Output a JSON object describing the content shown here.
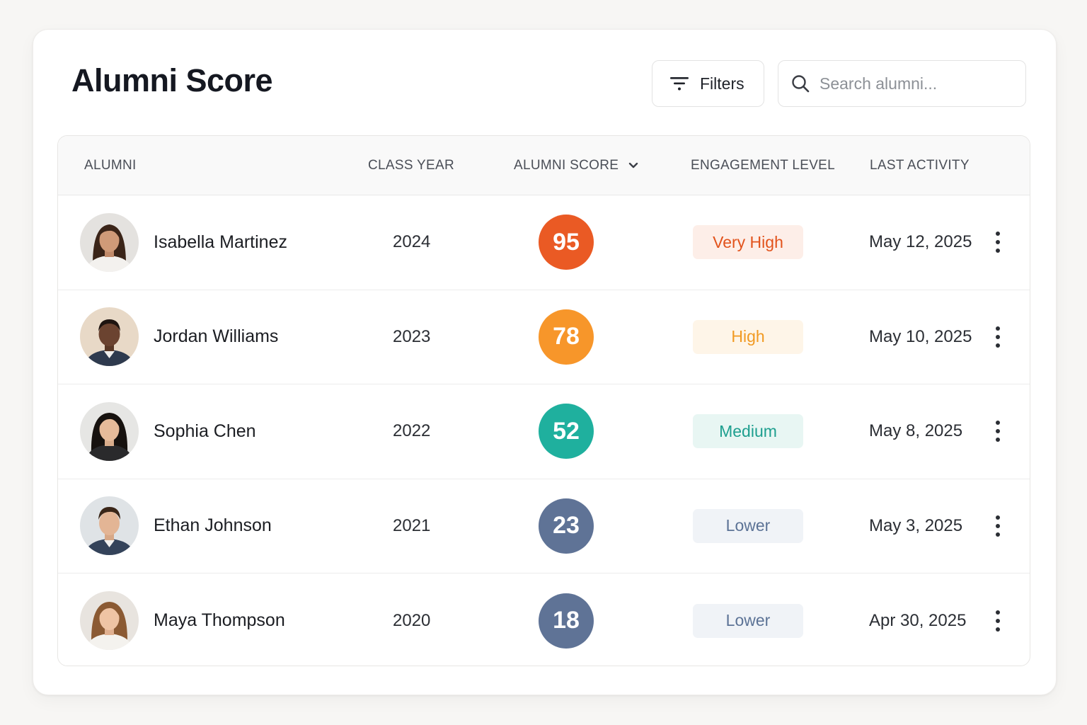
{
  "page": {
    "title": "Alumni Score",
    "filters_label": "Filters",
    "search_placeholder": "Search alumni..."
  },
  "columns": {
    "alumni": "ALUMNI",
    "class_year": "CLASS YEAR",
    "alumni_score": "ALUMNI SCORE",
    "engagement_level": "ENGAGEMENT LEVEL",
    "last_activity": "LAST ACTIVITY"
  },
  "rows": [
    {
      "name": "Isabella Martinez",
      "year": "2024",
      "score": "95",
      "level": "Very High",
      "last_activity": "May 12, 2025"
    },
    {
      "name": "Jordan Williams",
      "year": "2023",
      "score": "78",
      "level": "High",
      "last_activity": "May 10, 2025"
    },
    {
      "name": "Sophia Chen",
      "year": "2022",
      "score": "52",
      "level": "Medium",
      "last_activity": "May 8, 2025"
    },
    {
      "name": "Ethan Johnson",
      "year": "2021",
      "score": "23",
      "level": "Lower",
      "last_activity": "May 3, 2025"
    },
    {
      "name": "Maya Thompson",
      "year": "2020",
      "score": "18",
      "level": "Lower",
      "last_activity": "Apr 30, 2025"
    }
  ],
  "colors": {
    "score_very_high": "#ea5a24",
    "score_high": "#f7962a",
    "score_medium": "#1fb09e",
    "score_lower": "#5f7396",
    "badge_very_high_bg": "#fdeee8",
    "badge_very_high_text": "#e2531c",
    "badge_high_bg": "#fef5e8",
    "badge_high_text": "#f19a22",
    "badge_medium_bg": "#e8f6f3",
    "badge_medium_text": "#1e9f8f",
    "badge_lower_bg": "#f0f3f7",
    "badge_lower_text": "#5c7396"
  },
  "icons": {
    "filters": "filter-lines-icon",
    "search": "search-icon",
    "sort": "chevron-down-icon",
    "row_menu": "more-vertical-icon"
  }
}
